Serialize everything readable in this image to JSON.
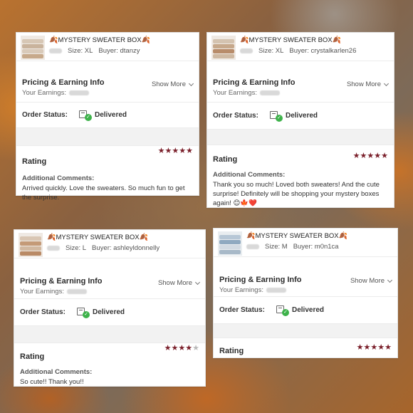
{
  "cards": [
    {
      "title": "MYSTERY SWEATER BOX",
      "size": "Size: XL",
      "buyer": "Buyer: dtanzy",
      "pricing_title": "Pricing & Earning Info",
      "earnings_label": "Your Earnings:",
      "show_more": "Show More",
      "status_label": "Order Status:",
      "status_value": "Delivered",
      "rating_title": "Rating",
      "stars": 5,
      "comments_title": "Additional Comments:",
      "comments_text": "Arrived quickly. Love the sweaters. So much fun to get the surprise."
    },
    {
      "title": "MYSTERY SWEATER BOX",
      "size": "Size: XL",
      "buyer": "Buyer: crystalkarlen26",
      "pricing_title": "Pricing & Earning Info",
      "earnings_label": "Your Earnings:",
      "show_more": "Show More",
      "status_label": "Order Status:",
      "status_value": "Delivered",
      "rating_title": "Rating",
      "stars": 5,
      "comments_title": "Additional Comments:",
      "comments_text": "Thank you so much! Loved both sweaters! And the cute surprise! Definitely will be shopping your mystery boxes again! 😊🍁❤️"
    },
    {
      "title": "MYSTERY SWEATER BOX",
      "size": "Size: L",
      "buyer": "Buyer: ashleyldonnelly",
      "pricing_title": "Pricing & Earning Info",
      "earnings_label": "Your Earnings:",
      "show_more": "Show More",
      "status_label": "Order Status:",
      "status_value": "Delivered",
      "rating_title": "Rating",
      "stars": 4,
      "comments_title": "Additional Comments:",
      "comments_text": "So cute!! Thank you!!"
    },
    {
      "title": "MYSTERY SWEATER BOX",
      "size": "Size: M",
      "buyer": "Buyer: m0n1ca",
      "pricing_title": "Pricing & Earning Info",
      "earnings_label": "Your Earnings:",
      "show_more": "Show More",
      "status_label": "Order Status:",
      "status_value": "Delivered",
      "rating_title": "Rating",
      "stars": 5
    }
  ],
  "icons": {
    "leaf": "autumn-leaf-icon",
    "box": "package-box-icon",
    "check": "check-circle-icon",
    "chevron": "chevron-down-icon",
    "star": "star-icon"
  },
  "colors": {
    "star_filled": "#7a1f2a",
    "star_empty": "#b9b9b9",
    "delivered_check": "#3db24a"
  }
}
